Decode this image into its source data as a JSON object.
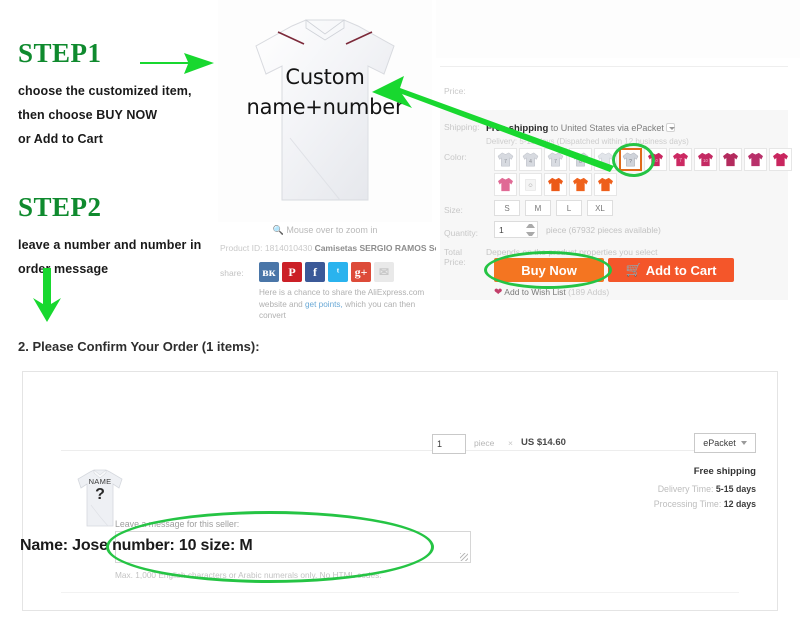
{
  "instructions": {
    "step1": {
      "title": "STEP1",
      "lines": [
        "choose the customized item,",
        "then choose BUY NOW",
        "or Add to Cart"
      ]
    },
    "step2": {
      "title": "STEP2",
      "lines": [
        "leave a number and number in",
        "order message"
      ]
    },
    "arrow_color": "#18d82f",
    "title_color": "#0f8a2e"
  },
  "product": {
    "overlay_line1": "Custom",
    "overlay_line2": "name+number",
    "zoom_hint": "Mouse over to zoom in",
    "product_id_label": "Product ID:",
    "product_id_value": "1814010430",
    "product_title": "Camisetas SERGIO RAMOS Soccer ...",
    "share_label": "share:",
    "share_icons": [
      {
        "name": "vk-icon",
        "glyph": "вк",
        "color": "#4a76a8"
      },
      {
        "name": "pinterest-icon",
        "glyph": "P",
        "color": "#cb2027"
      },
      {
        "name": "facebook-icon",
        "glyph": "f",
        "color": "#3b5998"
      },
      {
        "name": "twitter-icon",
        "glyph": "ᵗ",
        "color": "#2ab3ee"
      },
      {
        "name": "google-plus-icon",
        "glyph": "g+",
        "color": "#dd4b39"
      },
      {
        "name": "email-icon",
        "glyph": "✉",
        "color": "#e9e9e9"
      }
    ],
    "share_note_a": "Here is a chance to share the AliExpress.com",
    "share_note_b": "website and ",
    "share_note_link": "get points,",
    "share_note_c": " which you can then convert"
  },
  "detail": {
    "price_label": "Price:",
    "shipping_label": "Shipping:",
    "shipping_free": "Free shipping",
    "shipping_rest": " to United States via ePacket",
    "shipping_delivery": "Delivery: 5-15 days (Dispatched within 12 business days)",
    "color_label": "Color:",
    "size_label": "Size:",
    "sizes": [
      "S",
      "M",
      "L",
      "XL"
    ],
    "quantity_label": "Quantity:",
    "quantity_value": "1",
    "quantity_note": "piece (67932 pieces available)",
    "total_price_label": "Total Price:",
    "total_price_value": "Depends on the product properties you select",
    "buy_now_label": "Buy Now",
    "add_to_cart_label": "Add to Cart",
    "wish_label": "Add to Wish List",
    "wish_count": "(189 Adds)",
    "buy_now_color": "#f47521",
    "add_cart_color": "#f4562a",
    "selected_swatch_index": 5,
    "swatches_row1": [
      "#d7dae0",
      "#d7dae0",
      "#d9dce2",
      "#d2d6dd",
      "#e2e5ea",
      "#cfd3da",
      "#c9265f",
      "#cc2a63",
      "#c42a63",
      "#b42b5e",
      "#b8306a"
    ],
    "swatches_row2": [
      "#c9265f",
      "#e06a95",
      "#f4f4f4",
      "#ec5a18",
      "#ef621d",
      "#ee5f1b"
    ]
  },
  "confirm": {
    "title": "2. Please Confirm Your Order (1 items):",
    "mini_name": "NAME",
    "mini_number": "?",
    "qty_value": "1",
    "piece_label": "piece",
    "times": "×",
    "unit_price": "US $14.60",
    "shipping_method": "ePacket",
    "free_shipping": "Free shipping",
    "delivery_time_label": "Delivery Time:",
    "delivery_time_value": "5-15 days",
    "processing_time_label": "Processing Time:",
    "processing_time_value": "12 days",
    "leave_message_label": "Leave a message for this seller:",
    "message_value": "Name: Jose number: 10 size: M",
    "message_hint": "Max. 1,000 English characters or Arabic numerals only. No HTML codes."
  }
}
